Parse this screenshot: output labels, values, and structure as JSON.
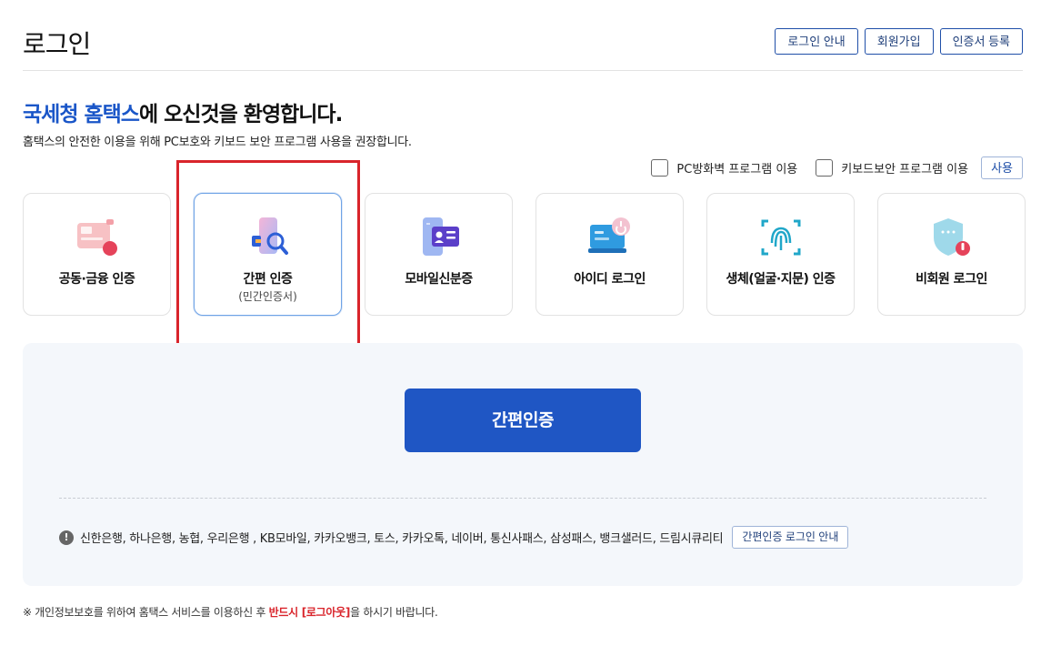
{
  "header": {
    "title": "로그인",
    "buttons": [
      "로그인 안내",
      "회원가입",
      "인증서 등록"
    ]
  },
  "welcome": {
    "brand": "국세청 홈택스",
    "rest": "에 오신것을 환영합니다.",
    "subtext": "홈택스의 안전한 이용을 위해 PC보호와 키보드 보안 프로그램 사용을 권장합니다."
  },
  "options": {
    "firewall_label": "PC방화벽 프로그램 이용",
    "keyboard_label": "키보드보안 프로그램 이용",
    "use_button": "사용"
  },
  "cards": [
    {
      "label": "공동·금융 인증",
      "icon": "certificate-icon"
    },
    {
      "label": "간편 인증",
      "sub": "(민간인증서)",
      "icon": "simple-auth-icon",
      "selected": true
    },
    {
      "label": "모바일신분증",
      "icon": "mobile-id-icon"
    },
    {
      "label": "아이디 로그인",
      "icon": "id-login-icon"
    },
    {
      "label": "생체(얼굴·지문) 인증",
      "icon": "fingerprint-icon"
    },
    {
      "label": "비회원 로그인",
      "icon": "guest-shield-icon"
    }
  ],
  "panel": {
    "main_button": "간편인증",
    "providers": "신한은행, 하나은행, 농협, 우리은행 , KB모바일, 카카오뱅크, 토스, 카카오톡, 네이버, 통신사패스, 삼성패스, 뱅크샐러드, 드림시큐리티",
    "guide_button": "간편인증 로그인 안내"
  },
  "footer": {
    "prefix": "※ 개인정보보호를 위하여 홈택스 서비스를 이용하신 후 ",
    "emphasis": "반드시 [로그아웃]",
    "suffix": "을 하시기 바랍니다."
  },
  "colors": {
    "brand_blue": "#1a56c8",
    "button_blue": "#1f56c4",
    "highlight_red": "#d9242b"
  }
}
